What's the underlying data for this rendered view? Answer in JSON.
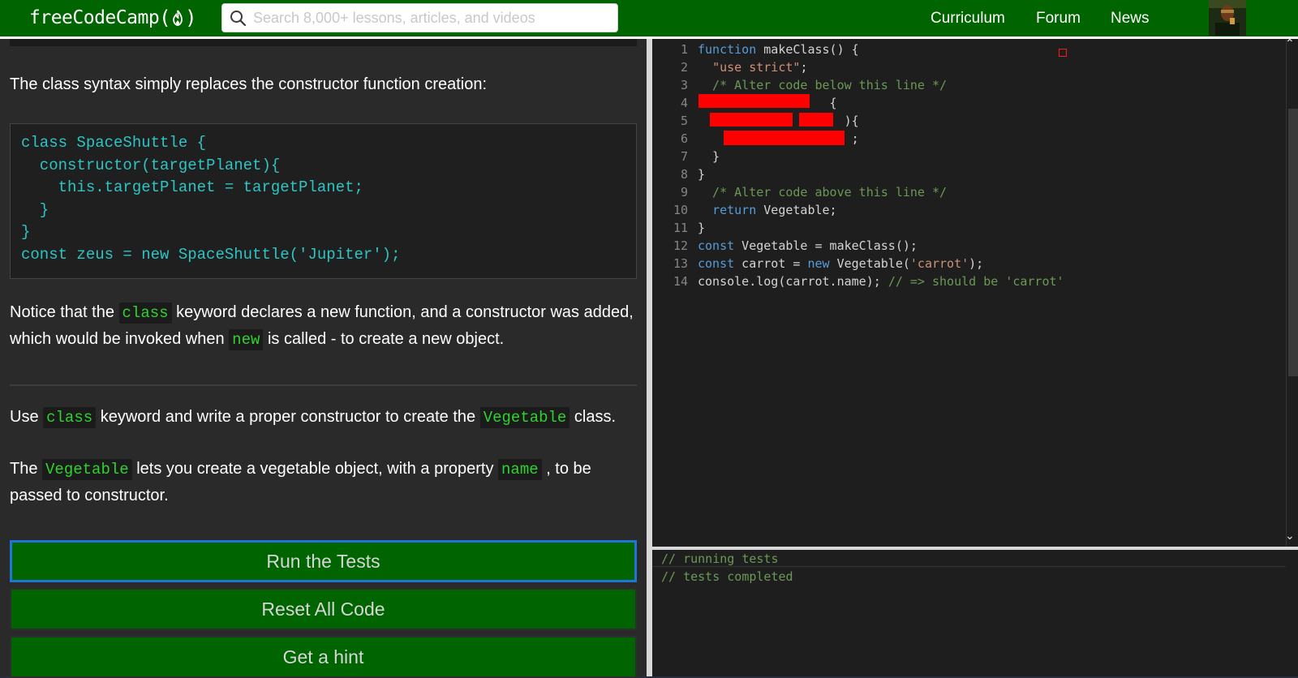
{
  "nav": {
    "logo_text": "freeCodeCamp",
    "logo_open": "(",
    "logo_close": ")",
    "search_placeholder": "Search 8,000+ lessons, articles, and videos",
    "links": [
      "Curriculum",
      "Forum",
      "News"
    ]
  },
  "lesson": {
    "intro": "The class syntax simply replaces the constructor function creation:",
    "example_code": "class SpaceShuttle {\n  constructor(targetPlanet){\n    this.targetPlanet = targetPlanet;\n  }\n}\nconst zeus = new SpaceShuttle('Jupiter');",
    "notice": {
      "p1": "Notice that the ",
      "c1": "class",
      "p2": " keyword declares a new function, and a constructor was added, which would be invoked when ",
      "c2": "new",
      "p3": " is called - to create a new object."
    },
    "task1": {
      "p1": "Use ",
      "c1": "class",
      "p2": " keyword and write a proper constructor to create the ",
      "c2": "Vegetable",
      "p3": " class."
    },
    "task2": {
      "p1": "The ",
      "c1": "Vegetable",
      "p2": " lets you create a vegetable object, with a property ",
      "c2": "name",
      "p3": " , to be passed to constructor."
    }
  },
  "buttons": {
    "run": "Run the Tests",
    "reset": "Reset All Code",
    "hint": "Get a hint"
  },
  "editor": {
    "lines": [
      {
        "n": "1",
        "tokens": [
          {
            "t": "function",
            "c": "kw"
          },
          {
            "t": " makeClass() {",
            "c": ""
          }
        ]
      },
      {
        "n": "2",
        "tokens": [
          {
            "t": "  ",
            "c": ""
          },
          {
            "t": "\"use strict\"",
            "c": "str"
          },
          {
            "t": ";",
            "c": ""
          }
        ]
      },
      {
        "n": "3",
        "tokens": [
          {
            "t": "  /* Alter code below this line */",
            "c": "cm"
          }
        ]
      },
      {
        "n": "4",
        "tokens": [
          {
            "t": "                  {",
            "c": ""
          }
        ]
      },
      {
        "n": "5",
        "tokens": [
          {
            "t": "              (     ){",
            "c": ""
          }
        ]
      },
      {
        "n": "6",
        "tokens": [
          {
            "t": "                     ;",
            "c": ""
          }
        ]
      },
      {
        "n": "7",
        "tokens": [
          {
            "t": "  }",
            "c": ""
          }
        ]
      },
      {
        "n": "8",
        "tokens": [
          {
            "t": "}",
            "c": ""
          }
        ]
      },
      {
        "n": "9",
        "tokens": [
          {
            "t": "  /* Alter code above this line */",
            "c": "cm"
          }
        ]
      },
      {
        "n": "10",
        "tokens": [
          {
            "t": "  ",
            "c": ""
          },
          {
            "t": "return",
            "c": "kw"
          },
          {
            "t": " Vegetable;",
            "c": ""
          }
        ]
      },
      {
        "n": "11",
        "tokens": [
          {
            "t": "}",
            "c": ""
          }
        ]
      },
      {
        "n": "12",
        "tokens": [
          {
            "t": "const",
            "c": "kw"
          },
          {
            "t": " Vegetable = makeClass();",
            "c": ""
          }
        ]
      },
      {
        "n": "13",
        "tokens": [
          {
            "t": "const",
            "c": "kw"
          },
          {
            "t": " carrot = ",
            "c": ""
          },
          {
            "t": "new",
            "c": "kw"
          },
          {
            "t": " Vegetable(",
            "c": ""
          },
          {
            "t": "'carrot'",
            "c": "str"
          },
          {
            "t": ");",
            "c": ""
          }
        ]
      },
      {
        "n": "14",
        "tokens": [
          {
            "t": "console.log(carrot.name); ",
            "c": ""
          },
          {
            "t": "// => should be 'carrot'",
            "c": "cm"
          }
        ]
      }
    ]
  },
  "console": {
    "lines": [
      "// running tests",
      "// tests completed"
    ]
  },
  "colors": {
    "brand_green": "#006400",
    "inline_code": "#2fd22f",
    "example_code": "#2ec4c4",
    "redaction": "#ff0000",
    "focus_ring": "#1e74d8"
  }
}
